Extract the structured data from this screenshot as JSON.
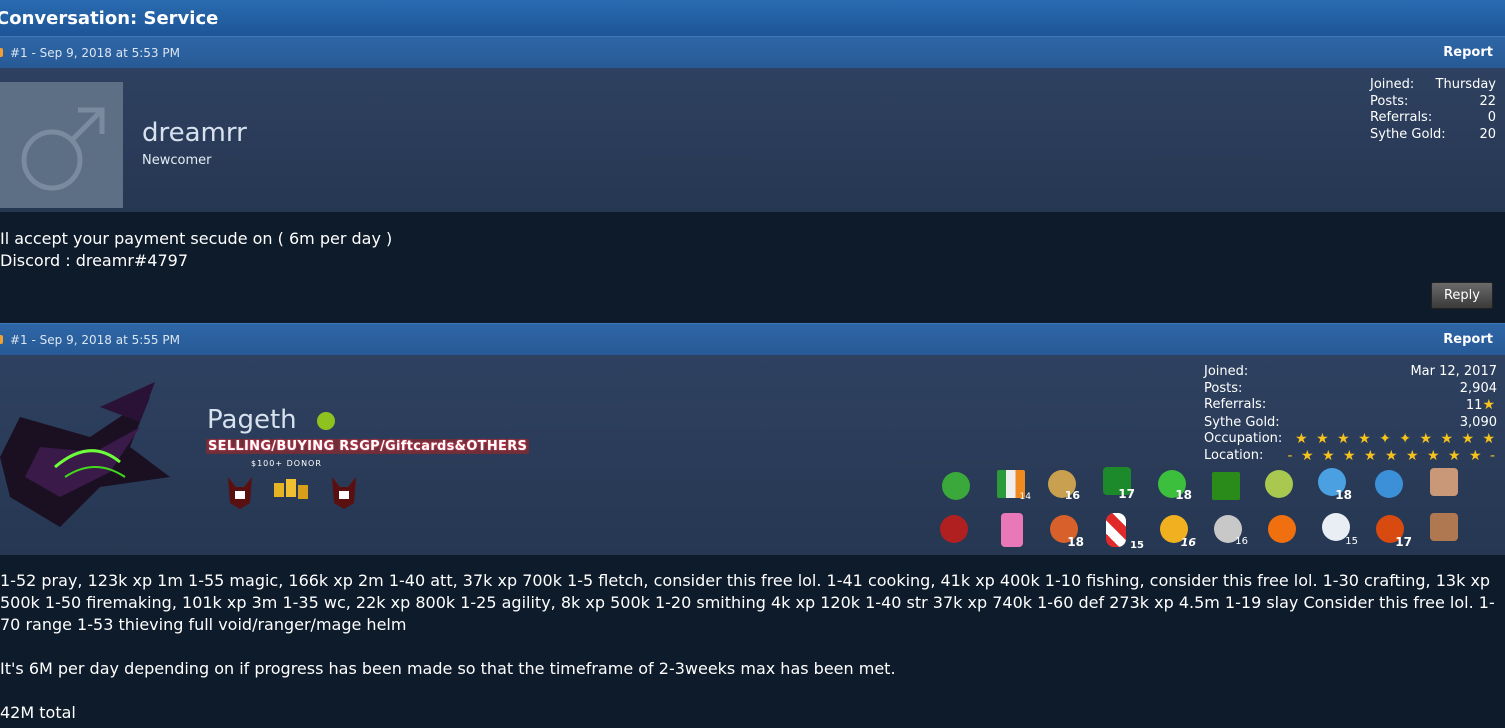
{
  "page": {
    "title": "Conversation: Service"
  },
  "posts": [
    {
      "number": "#1",
      "date": "Sep 9, 2018 at 5:53 PM",
      "report": "Report",
      "username": "dreamrr",
      "rank": "Newcomer",
      "stats": [
        {
          "label": "Joined:",
          "value": "Thursday"
        },
        {
          "label": "Posts:",
          "value": "22"
        },
        {
          "label": "Referrals:",
          "value": "0"
        },
        {
          "label": "Sythe Gold:",
          "value": "20"
        }
      ],
      "body": [
        "Il accept your payment secude on ( 6m per day )",
        "Discord : dreamr#4797"
      ],
      "reply": "Reply"
    },
    {
      "number": "#1",
      "date": "Sep 9, 2018 at 5:55 PM",
      "report": "Report",
      "username": "Pageth",
      "usertitle": "SELLING/BUYING RSGP/Giftcards&OTHERS",
      "donor": "$100+  DONOR",
      "stats": [
        {
          "label": "Joined:",
          "value": "Mar 12, 2017"
        },
        {
          "label": "Posts:",
          "value": "2,904"
        },
        {
          "label": "Referrals:",
          "value": "11"
        },
        {
          "label": "Sythe Gold:",
          "value": "3,090"
        },
        {
          "label": "Occupation:",
          "value": "★ ★ ★ ★ ✦ ✦ ★ ★ ★ ★"
        },
        {
          "label": "Location:",
          "value": "- ★ ★ ★ ★ ★ ★ ★ ★ ★ -"
        }
      ],
      "body": [
        "1-52 pray, 123k xp 1m 1-55 magic, 166k xp 2m 1-40 att, 37k xp 700k 1-5 fletch, consider this free lol. 1-41 cooking, 41k xp 400k 1-10 fishing, consider this free lol. 1-30 crafting, 13k xp 500k 1-50 firemaking, 101k xp 3m 1-35 wc, 22k xp 800k 1-25 agility, 8k xp 500k 1-20 smithing 4k xp 120k 1-40 str 37k xp 740k 1-60 def 273k xp 4.5m 1-19 slay Consider this free lol. 1-70 range 1-53 thieving full void/ranger/mage helm",
        "It's 6M per day depending on if progress has been made so that the timeframe of 2-3weeks max has been met.",
        "42M total"
      ],
      "award_numbers": [
        "",
        "14",
        "16",
        "17",
        "18",
        "",
        "",
        "18",
        "",
        "",
        "",
        "",
        "18",
        "15",
        "16",
        "16",
        "",
        "15",
        "17",
        ""
      ]
    }
  ]
}
